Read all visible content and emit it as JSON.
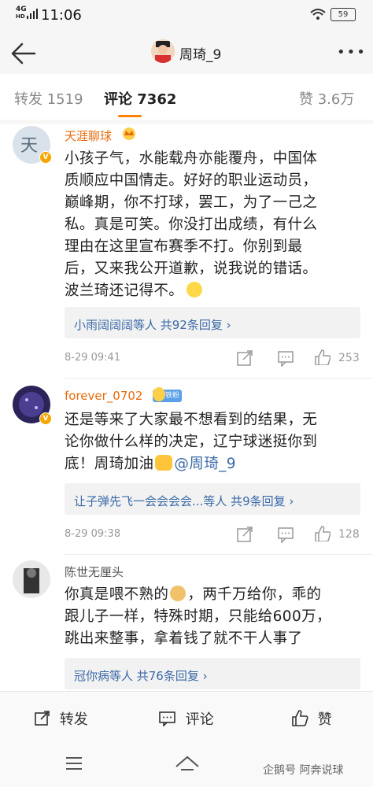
{
  "status_bar": {
    "network": "4G",
    "signal_sub": "HD",
    "time": "11:06",
    "battery": "59"
  },
  "header": {
    "title": "周琦_9"
  },
  "tabs": [
    {
      "label": "转发 1519"
    },
    {
      "label": "评论 7362"
    },
    {
      "label": "赞 3.6万"
    }
  ],
  "comments": [
    {
      "name": "天涯聊球",
      "lines": [
        "小孩子气，水能载舟亦能覆舟，中国体",
        "质顺应中国情走。好好的职业运动员，",
        "巅峰期，你不打球，罢工，为了一己之",
        "私。真是可笑。你没打出成绩，有什么",
        "理由在这里宣布赛季不打。你别到最",
        "后，又来我公开道歉，说我说的错话。",
        "波兰琦还记得不。"
      ],
      "reply": "小雨阔阔阔等人  共92条回复 ›",
      "time": "8-29 09:41",
      "likes": "253"
    },
    {
      "name": "forever_0702",
      "fan_badge": "铁粉",
      "lines": [
        "还是等来了大家最不想看到的结果，无",
        "论你做什么样的决定，辽宁球迷挺你到",
        "底！周琦加油"
      ],
      "mention": "@周琦_9",
      "reply": "让子弹先飞一会会会会...等人  共9条回复 ›",
      "time": "8-29 09:38",
      "likes": "128"
    },
    {
      "name": "陈世无厘头",
      "lines": [
        "你真是喂不熟的",
        "，两千万给你，乖的",
        "跟儿子一样，特殊时期，只能给600万，",
        "跳出来整事，拿着钱了就不干人事了"
      ],
      "reply": "冠你病等人  共76条回复 ›"
    }
  ],
  "bottom_bar": {
    "repost": "转发",
    "comment": "评论",
    "like": "赞"
  },
  "watermark": "企鹅号 阿奔说球",
  "colors": {
    "accent": "#ff8200",
    "link": "#3b6aa8",
    "vip_name": "#e86b0d"
  }
}
